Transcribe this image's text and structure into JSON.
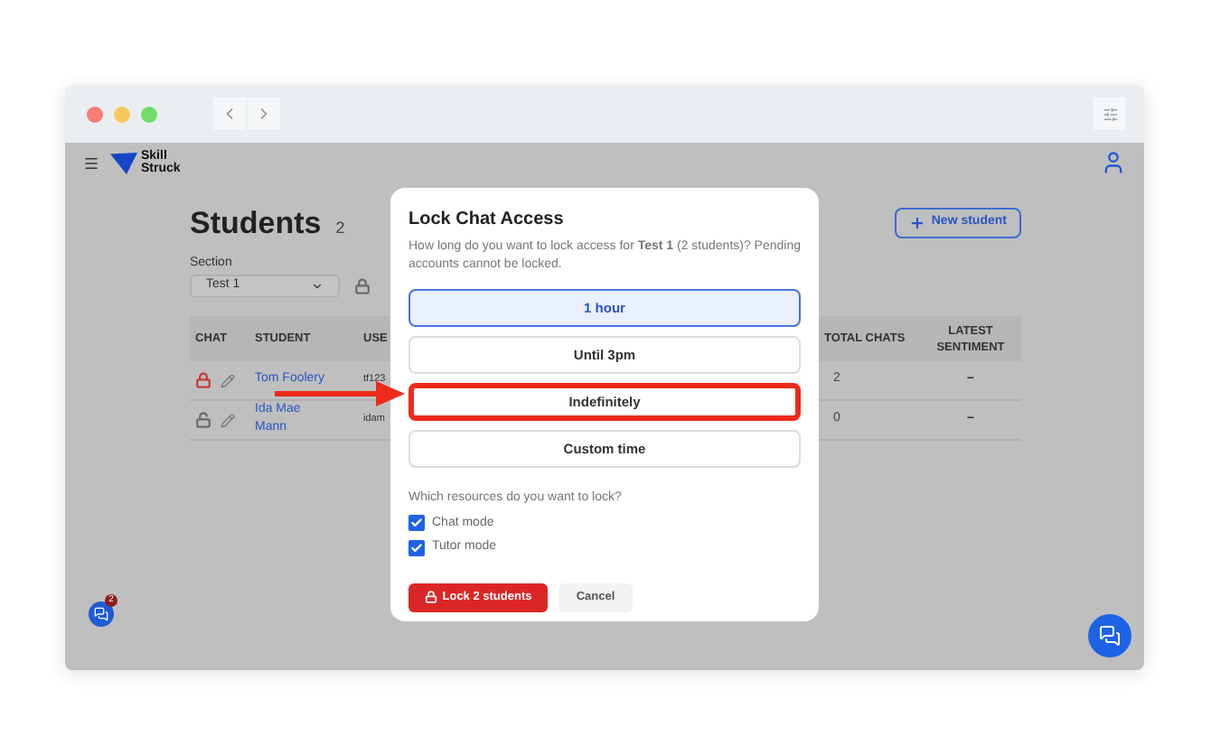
{
  "brand": {
    "lines": [
      "Skill",
      "Struck"
    ]
  },
  "page": {
    "title": "Students",
    "count": "2",
    "section_label": "Section",
    "section_value": "Test 1",
    "new_button": "New student"
  },
  "table": {
    "columns": [
      "CHAT",
      "STUDENT",
      "USE",
      "TOTAL CHATS",
      "LATEST SENTIMENT"
    ],
    "rows": [
      {
        "locked": true,
        "student": "Tom Foolery",
        "username": "tf123",
        "total_chats": "2",
        "latest_sentiment": "–"
      },
      {
        "locked": false,
        "student": "Ida Mae Mann",
        "username": "idam",
        "total_chats": "0",
        "latest_sentiment": "–"
      }
    ]
  },
  "modal": {
    "title": "Lock Chat Access",
    "description": "How long do you want to lock access for **Test 1** (2 students)? Pending accounts cannot be locked.",
    "options": [
      {
        "label": "1 hour",
        "selected": true,
        "highlighted": false
      },
      {
        "label": "Until 3pm",
        "selected": false,
        "highlighted": false
      },
      {
        "label": "Indefinitely",
        "selected": false,
        "highlighted": true
      },
      {
        "label": "Custom time",
        "selected": false,
        "highlighted": false
      }
    ],
    "resources_label": "Which resources do you want to lock?",
    "resources": [
      {
        "label": "Chat mode",
        "checked": true
      },
      {
        "label": "Tutor mode",
        "checked": true
      }
    ],
    "primary_button": "Lock 2 students",
    "secondary_button": "Cancel"
  },
  "notifications": {
    "badge": "2"
  }
}
